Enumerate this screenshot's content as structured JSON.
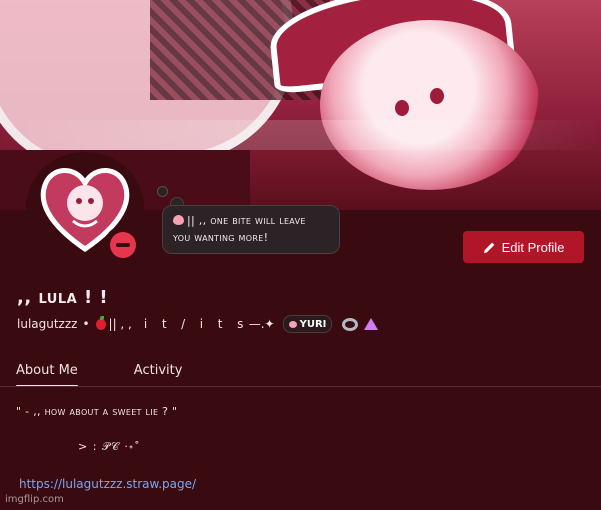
{
  "profile": {
    "display_name_prefix": ",, ",
    "display_name_core": "lula",
    "display_name_suffix": " ! !",
    "username": "lulagutzzz",
    "separator": "•",
    "pronouns_lead": "|| , ,",
    "pronouns_text": "i t / i t s",
    "pronouns_tail": "—.✦",
    "tag_label": "YURI",
    "status": "do-not-disturb"
  },
  "custom_status": {
    "line1": "|| ,, one bite will leave",
    "line2": "you wanting more!"
  },
  "actions": {
    "edit_profile_label": "Edit Profile"
  },
  "tabs": [
    {
      "label": "About Me",
      "active": true
    },
    {
      "label": "Activity",
      "active": false
    }
  ],
  "about_me": {
    "line1": "\" - ,, how about a sweet lie ? \"",
    "line2": "> : 𝒫𝒞 ·˖˚",
    "link": "https://lulagutzzz.straw.page/"
  },
  "watermark": "imgflip.com",
  "colors": {
    "background": "#3a0a11",
    "accent_button": "#b01628",
    "status_dnd": "#e8354e",
    "link": "#78a7f5"
  },
  "icons": [
    "pencil-icon",
    "dnd-status-icon",
    "heart-emoji-icon",
    "apple-emoji-icon",
    "nitro-boost-icon",
    "gem-icon"
  ]
}
